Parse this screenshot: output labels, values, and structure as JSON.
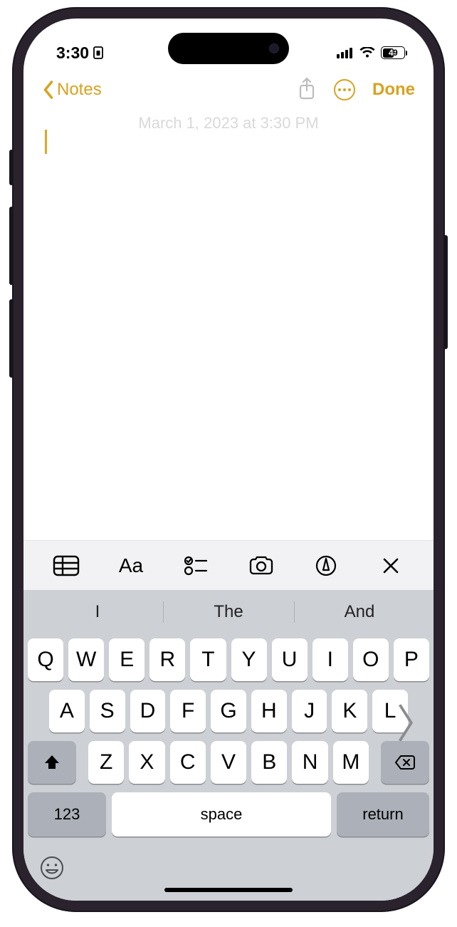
{
  "status": {
    "time": "3:30",
    "battery_pct": "49"
  },
  "nav": {
    "back_label": "Notes",
    "done_label": "Done"
  },
  "editor": {
    "timestamp_watermark": "March 1, 2023 at 3:30 PM"
  },
  "format_toolbar": {
    "aa_label": "Aa"
  },
  "keyboard": {
    "suggestions": [
      "I",
      "The",
      "And"
    ],
    "row1": [
      "Q",
      "W",
      "E",
      "R",
      "T",
      "Y",
      "U",
      "I",
      "O",
      "P"
    ],
    "row2": [
      "A",
      "S",
      "D",
      "F",
      "G",
      "H",
      "J",
      "K",
      "L"
    ],
    "row3": [
      "Z",
      "X",
      "C",
      "V",
      "B",
      "N",
      "M"
    ],
    "k123": "123",
    "space": "space",
    "return": "return"
  }
}
